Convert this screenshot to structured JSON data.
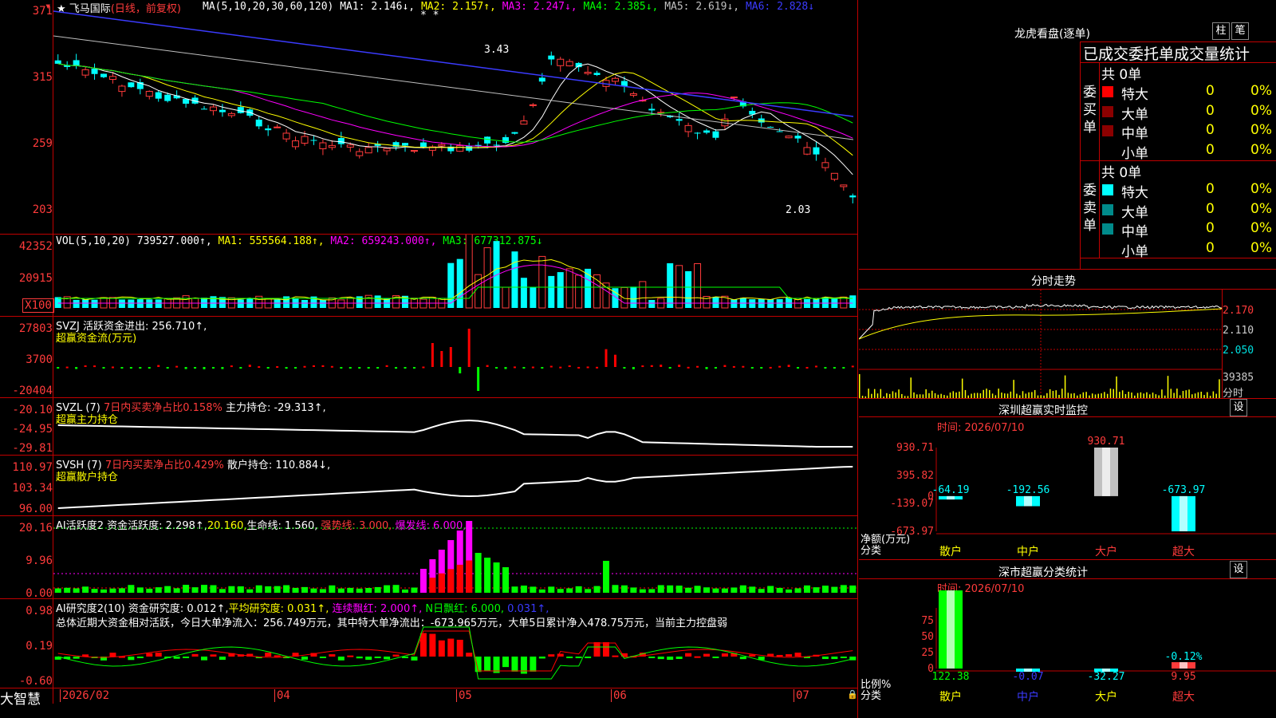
{
  "stock": {
    "star": "★",
    "name": "飞马国际",
    "mode": "(日线，前复权)"
  },
  "ma_header": [
    {
      "text": "MA(5,10,20,30,60,120)",
      "color": "#ffffff"
    },
    {
      "text": "MA1: 2.146↓,",
      "color": "#ffffff"
    },
    {
      "text": "MA2: 2.157↑,",
      "color": "#ffff00"
    },
    {
      "text": "MA3: 2.247↓,",
      "color": "#ff00ff"
    },
    {
      "text": "MA4: 2.385↓,",
      "color": "#00ff00"
    },
    {
      "text": "MA5: 2.619↓,",
      "color": "#c0c0c0"
    },
    {
      "text": "MA6: 2.828↓",
      "color": "#3b3bff"
    }
  ],
  "price_axis": [
    "371",
    "315",
    "259",
    "203"
  ],
  "price_marks": {
    "high": "3.43",
    "low": "2.03",
    "stars": "* *"
  },
  "vol_header": [
    {
      "text": "VOL(5,10,20) 739527.000↑,",
      "color": "#ffffff"
    },
    {
      "text": "MA1: 555564.188↑,",
      "color": "#ffff00"
    },
    {
      "text": "MA2: 659243.000↑,",
      "color": "#ff00ff"
    },
    {
      "text": "MA3: 677312.875↓",
      "color": "#00ff00"
    }
  ],
  "vol_axis": [
    "42352",
    "20915",
    "X100"
  ],
  "svzj": {
    "header": "SVZJ  活跃资金进出: 256.710↑,",
    "sub": "超赢资金流(万元)",
    "axis": [
      "27803",
      "3700",
      "-20404"
    ]
  },
  "svzl": {
    "header1": "SVZL (7)",
    "header2": "7日内买卖净占比0.158%",
    "header3": "主力持仓: -29.313↑,",
    "sub": "超赢主力持仓",
    "axis": [
      "-20.10",
      "-24.95",
      "-29.81"
    ]
  },
  "svsh": {
    "header1": "SVSH (7)",
    "header2": "7日内买卖净占比0.429%",
    "header3": "散户持仓: 110.884↓,",
    "sub": "超赢散户持仓",
    "axis": [
      "110.97",
      "103.34",
      "96.00"
    ]
  },
  "ai1": {
    "h1": "AI活跃度2 资金活跃度: 2.298↑,",
    "h2": "20.160,",
    "h3": "生命线: 1.560,",
    "h4": "强势线: 3.000,",
    "h5": "爆发线: 6.000,",
    "axis": [
      "20.16",
      "9.96",
      "0.00"
    ]
  },
  "ai2": {
    "h1": "AI研究度2(10) 资金研究度: 0.012↑,",
    "h2": "平均研究度: 0.031↑,",
    "h3": "连续飘红: 2.000↑,",
    "h4": "N日飘红: 6.000,",
    "h5": "0.031↑,",
    "summary": "总体近期大资金相对活跃，今日大单净流入：256.749万元，其中特大单净流出：-673.965万元，大单5日累计净入478.75万元，当前主力控盘弱",
    "axis": [
      "0.98",
      "0.19",
      "-0.60"
    ]
  },
  "date_axis": [
    "2026/02",
    "04",
    "05",
    "06",
    "07"
  ],
  "brand": "大智慧",
  "longhu": {
    "title": "龙虎看盘(逐单)",
    "btn1": "柱",
    "btn2": "笔",
    "subtitle": "已成交委托单成交量统计",
    "buy_label": "委买单",
    "sell_label": "委卖单",
    "buy_total": "共 0单",
    "sell_total": "共 0单",
    "rows": [
      "特大",
      "大单",
      "中单",
      "小单"
    ],
    "zero": "0",
    "pct": "0%"
  },
  "fenshi": {
    "title": "分时走势",
    "axis": [
      "2.170",
      "2.110",
      "2.050"
    ],
    "vol": "39385",
    "label": "分时"
  },
  "sz_monitor": {
    "title": "深圳超赢实时监控",
    "btn": "设",
    "time": "时间: 2026/07/10",
    "axis": [
      "930.71",
      "395.82",
      "0",
      "-139.07",
      "-673.97"
    ],
    "cats": [
      "散户",
      "中户",
      "大户",
      "超大"
    ],
    "vals": [
      "-64.19",
      "-192.56",
      "930.71",
      "-673.97"
    ],
    "ylabel1": "净额(万元)",
    "ylabel2": "分类"
  },
  "sz_class": {
    "title": "深市超赢分类统计",
    "btn": "设",
    "time": "时间: 2026/07/10",
    "axis": [
      "75",
      "50",
      "25",
      "0"
    ],
    "cats": [
      "散户",
      "中户",
      "大户",
      "超大"
    ],
    "vals": [
      "122.38",
      "-0.07",
      "-32.27",
      "9.95"
    ],
    "note": "-0.12%",
    "ylabel1": "比例%",
    "ylabel2": "分类"
  },
  "chart_data": [
    {
      "type": "bar",
      "title": "深圳超赢实时监控",
      "categories": [
        "散户",
        "中户",
        "大户",
        "超大"
      ],
      "values": [
        -64.19,
        -192.56,
        930.71,
        -673.97
      ],
      "ylabel": "净额(万元)",
      "ylim": [
        -673.97,
        930.71
      ]
    },
    {
      "type": "bar",
      "title": "深市超赢分类统计",
      "categories": [
        "散户",
        "中户",
        "大户",
        "超大"
      ],
      "values": [
        122.38,
        -0.07,
        -32.27,
        9.95
      ],
      "ylabel": "比例%"
    }
  ]
}
